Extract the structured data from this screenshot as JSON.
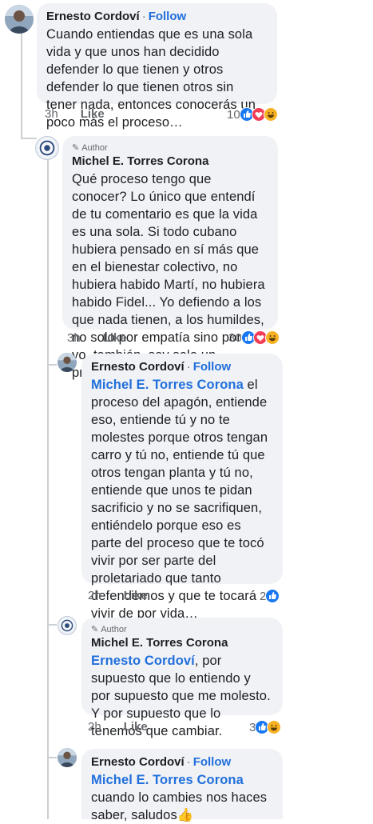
{
  "comments": [
    {
      "author": "Ernesto Cordoví",
      "follow": "Follow",
      "badge": "",
      "mention": "",
      "text": "Cuando entiendas que es una sola vida y que unos han decidido defender lo que tienen y otros defender lo que tienen otros sin tener nada, entonces conocerás un poco más el proceso…",
      "time": "3h",
      "like": "Like",
      "reaction_count": "10",
      "reactions": [
        "like",
        "love",
        "haha"
      ]
    },
    {
      "author": "Michel E. Torres Corona",
      "follow": "",
      "badge": "Author",
      "mention": "",
      "text": "Qué proceso tengo que conocer? Lo único que entendí de tu comentario es que la vida es una sola. Si todo cubano hubiera pensado en sí más que en el bienestar colectivo, no hubiera habido Martí, no hubiera habido Fidel... Yo defiendo a los que nada tienen, a los humildes, no solo por empatía sino porque yo, también, soy solo un proletario más.",
      "time": "3h",
      "like": "Like",
      "reaction_count": "30",
      "reactions": [
        "like",
        "love",
        "haha"
      ]
    },
    {
      "author": "Ernesto Cordoví",
      "follow": "Follow",
      "badge": "",
      "mention": "Michel E. Torres Corona",
      "text": " el proceso del apagón, entiende eso, entiende tú y no te molestes porque otros tengan carro y tú no, entiende tú que otros tengan planta y tú no, entiende que unos te pidan sacrificio y no se sacrifiquen, entiéndelo porque eso es parte del proceso que te tocó vivir por ser parte del proletariado que tanto defendemos y que te tocará vivir de por vida…",
      "time": "2h",
      "like": "Like",
      "reaction_count": "2",
      "reactions": [
        "like"
      ]
    },
    {
      "author": "Michel E. Torres Corona",
      "follow": "",
      "badge": "Author",
      "mention": "Ernesto Cordoví",
      "text": ", por supuesto que lo entiendo y por supuesto que me molesto. Y por supuesto que lo tenemos que cambiar.",
      "time": "2h",
      "like": "Like",
      "reaction_count": "3",
      "reactions": [
        "like",
        "haha"
      ]
    },
    {
      "author": "Ernesto Cordoví",
      "follow": "Follow",
      "badge": "",
      "mention": "Michel E. Torres Corona",
      "text": " cuando lo cambies nos haces saber, saludos",
      "emoji": "👍",
      "time": "",
      "like": "",
      "reaction_count": "",
      "reactions": []
    }
  ],
  "colors": {
    "accent": "#216fdb",
    "bubble": "#f0f2f5",
    "like": "#1877f2",
    "love": "#f33e58",
    "haha": "#f7b125"
  }
}
